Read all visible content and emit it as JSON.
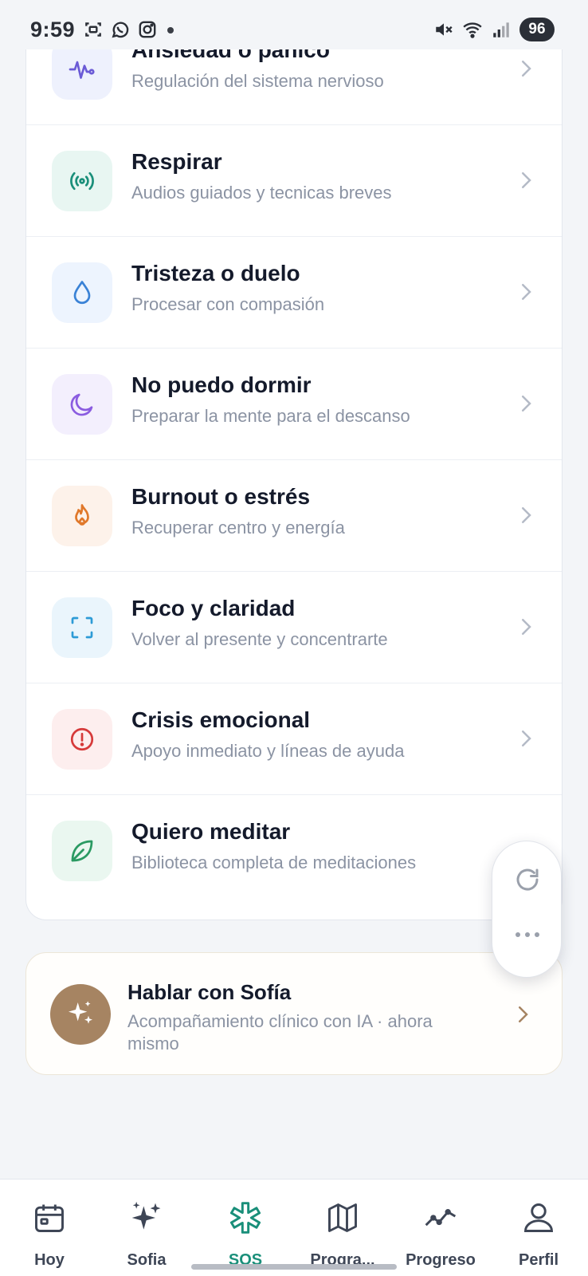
{
  "status_bar": {
    "time": "9:59",
    "battery": "96"
  },
  "menu_items": [
    {
      "title": "Ansiedad o pánico",
      "subtitle": "Regulación del sistema nervioso",
      "icon": "pulse-icon",
      "icon_bg": "#eef1fd",
      "icon_color": "#6b5bd6"
    },
    {
      "title": "Respirar",
      "subtitle": "Audios guiados y tecnicas breves",
      "icon": "broadcast-icon",
      "icon_bg": "#e8f6f2",
      "icon_color": "#1a8f7a"
    },
    {
      "title": "Tristeza o duelo",
      "subtitle": "Procesar con compasión",
      "icon": "droplet-icon",
      "icon_bg": "#edf4fe",
      "icon_color": "#3a82d6"
    },
    {
      "title": "No puedo dormir",
      "subtitle": "Preparar la mente para el descanso",
      "icon": "moon-icon",
      "icon_bg": "#f3effd",
      "icon_color": "#8a5ce0"
    },
    {
      "title": "Burnout o estrés",
      "subtitle": "Recuperar centro y energía",
      "icon": "flame-icon",
      "icon_bg": "#fdf2ea",
      "icon_color": "#e0782a"
    },
    {
      "title": "Foco y claridad",
      "subtitle": "Volver al presente y concentrarte",
      "icon": "focus-icon",
      "icon_bg": "#eaf5fc",
      "icon_color": "#2d9bd6"
    },
    {
      "title": "Crisis emocional",
      "subtitle": "Apoyo inmediato y líneas de ayuda",
      "icon": "alert-icon",
      "icon_bg": "#fdeeee",
      "icon_color": "#d63a3a"
    },
    {
      "title": "Quiero meditar",
      "subtitle": "Biblioteca completa de meditaciones",
      "icon": "leaf-icon",
      "icon_bg": "#eaf7f0",
      "icon_color": "#2a9a62"
    }
  ],
  "sofia_card": {
    "title": "Hablar con Sofía",
    "subtitle": "Acompañamiento clínico con IA · ahora mismo",
    "avatar_color": "#a68462"
  },
  "bottom_nav": [
    {
      "label": "Hoy",
      "icon": "calendar-icon"
    },
    {
      "label": "Sofia",
      "icon": "sparkles-icon"
    },
    {
      "label": "SOS",
      "icon": "asterisk-icon",
      "active": true
    },
    {
      "label": "Progra...",
      "icon": "map-icon"
    },
    {
      "label": "Progreso",
      "icon": "trend-icon"
    },
    {
      "label": "Perfil",
      "icon": "user-icon"
    }
  ],
  "colors": {
    "accent": "#1a8f7a",
    "chevron": "#b4bac6",
    "sofia_chevron": "#a68462"
  }
}
